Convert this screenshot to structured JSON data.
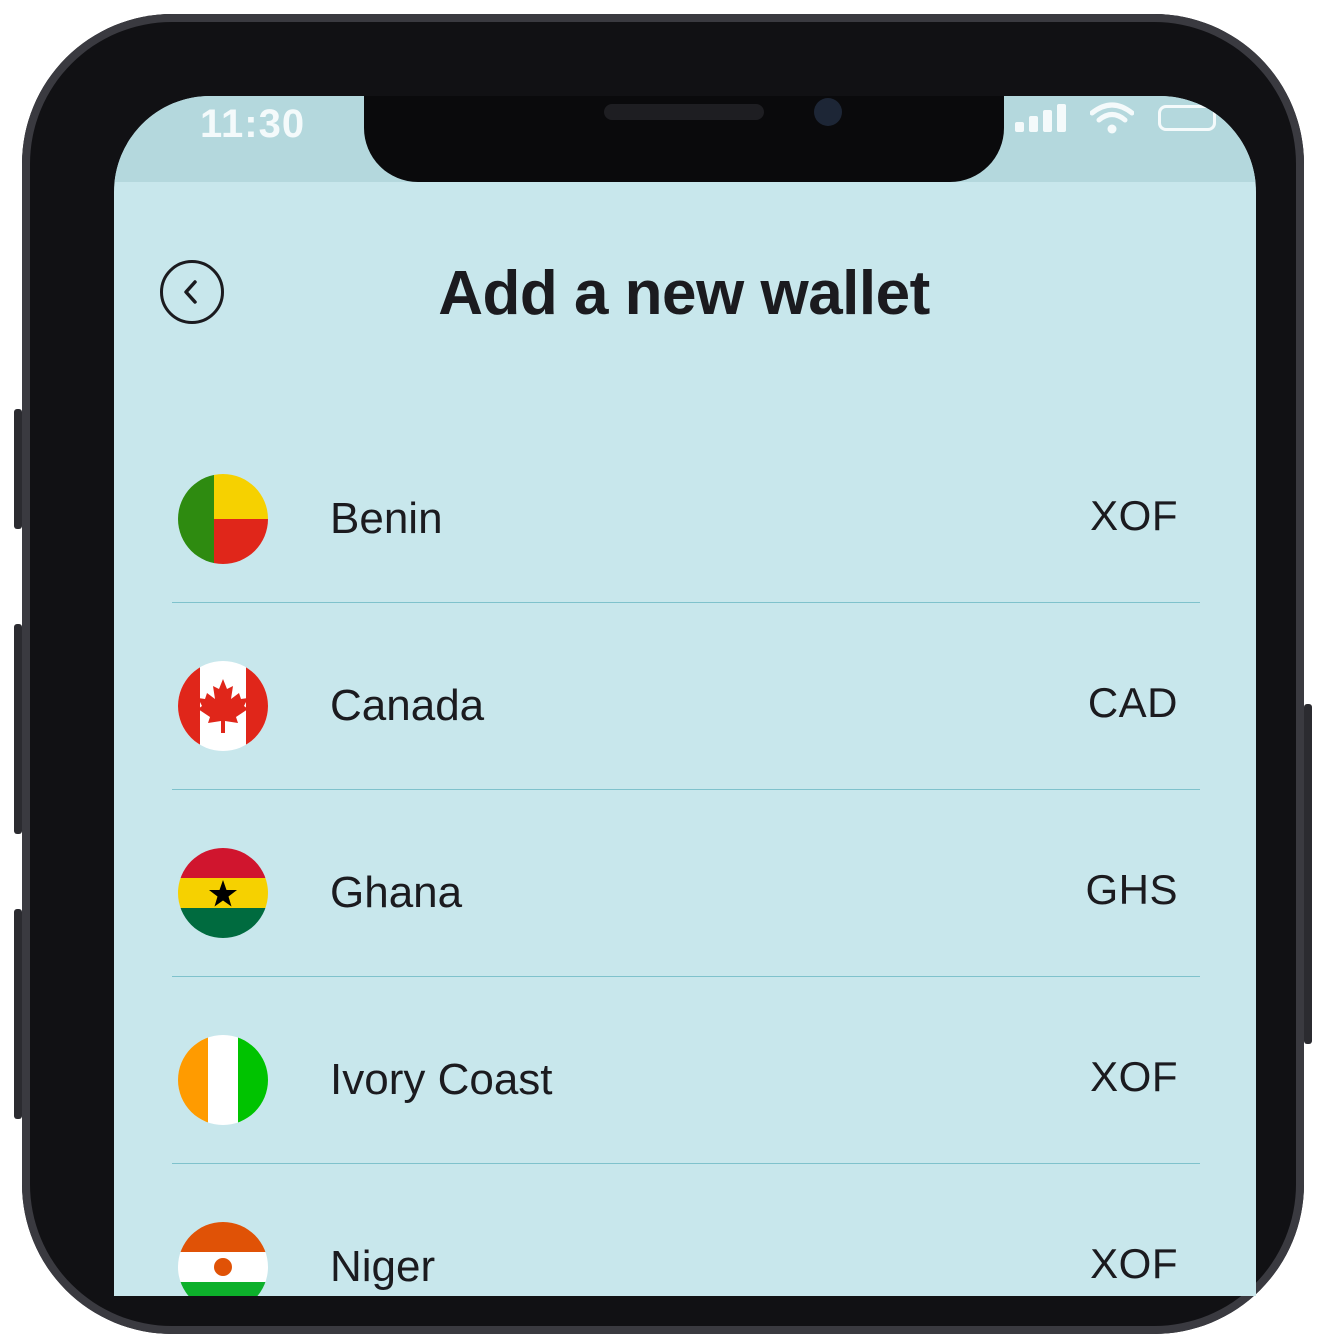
{
  "status_bar": {
    "time": "11:30"
  },
  "header": {
    "title": "Add a new wallet"
  },
  "wallets": [
    {
      "country": "Benin",
      "currency": "XOF",
      "flag_icon": "benin-flag-icon"
    },
    {
      "country": "Canada",
      "currency": "CAD",
      "flag_icon": "canada-flag-icon"
    },
    {
      "country": "Ghana",
      "currency": "GHS",
      "flag_icon": "ghana-flag-icon"
    },
    {
      "country": "Ivory Coast",
      "currency": "XOF",
      "flag_icon": "ivory-coast-flag-icon"
    },
    {
      "country": "Niger",
      "currency": "XOF",
      "flag_icon": "niger-flag-icon"
    }
  ],
  "colors": {
    "background": "#c8e7ec",
    "divider": "#7fc2cc",
    "text": "#1b1b1f"
  }
}
